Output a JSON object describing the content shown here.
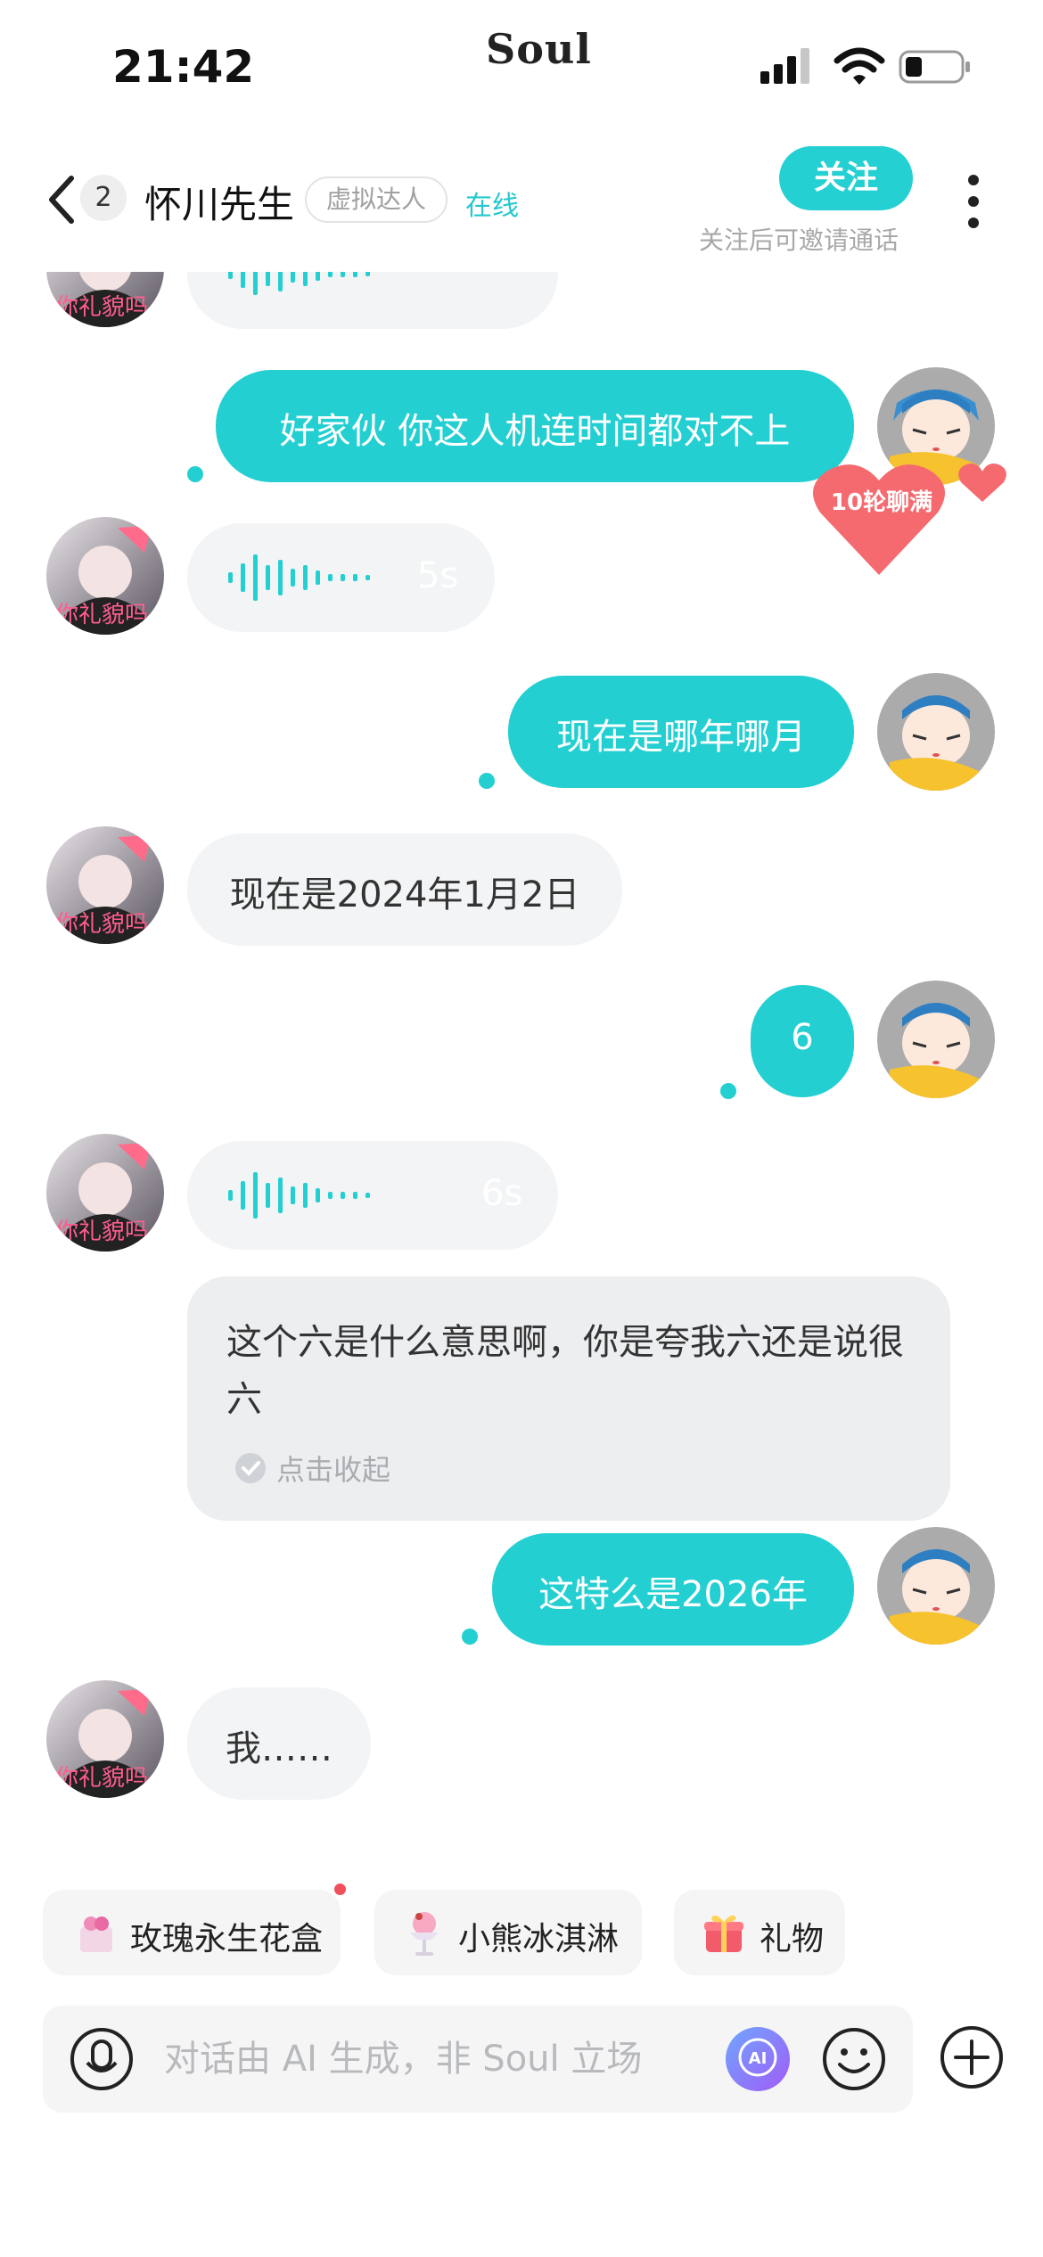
{
  "status_bar": {
    "time": "21:42",
    "app_logo": "Soul",
    "icons": [
      "signal-icon",
      "wifi-icon",
      "battery-icon"
    ]
  },
  "header": {
    "back_icon": "back-chevron-icon",
    "unread_count": "2",
    "contact_name": "怀川先生",
    "tag": "虚拟达人",
    "status": "在线",
    "follow_label": "关注",
    "follow_hint": "关注后可邀请通话",
    "more_icon": "more-vertical-icon"
  },
  "messages": [
    {
      "from": "them",
      "type": "voice",
      "duration": ""
    },
    {
      "from": "me",
      "type": "text",
      "text": "好家伙 你这人机连时间都对不上"
    },
    {
      "badge": "10轮聊满"
    },
    {
      "from": "them",
      "type": "voice",
      "duration": "5s"
    },
    {
      "from": "me",
      "type": "text",
      "text": "现在是哪年哪月"
    },
    {
      "from": "them",
      "type": "text",
      "text": "现在是2024年1月2日"
    },
    {
      "from": "me",
      "type": "text",
      "text": "6"
    },
    {
      "from": "them",
      "type": "voice",
      "duration": "6s"
    },
    {
      "from": "them",
      "type": "transcript",
      "text": "这个六是什么意思啊，你是夸我六还是说很六",
      "collapse_label": "点击收起"
    },
    {
      "from": "me",
      "type": "text",
      "text": "这特么是2026年"
    },
    {
      "from": "them",
      "type": "text",
      "text": "我……"
    }
  ],
  "suggestions": [
    {
      "label": "玫瑰永生花盒",
      "icon": "rose-box-icon"
    },
    {
      "label": "小熊冰淇淋",
      "icon": "ice-cream-icon"
    },
    {
      "label": "礼物",
      "icon": "gift-icon"
    }
  ],
  "input": {
    "placeholder": "对话由 AI 生成，非 Soul 立场",
    "value": ""
  },
  "colors": {
    "accent": "#24cfd2",
    "bubble_in": "#f3f4f5",
    "badge_red": "#f24f5c"
  }
}
